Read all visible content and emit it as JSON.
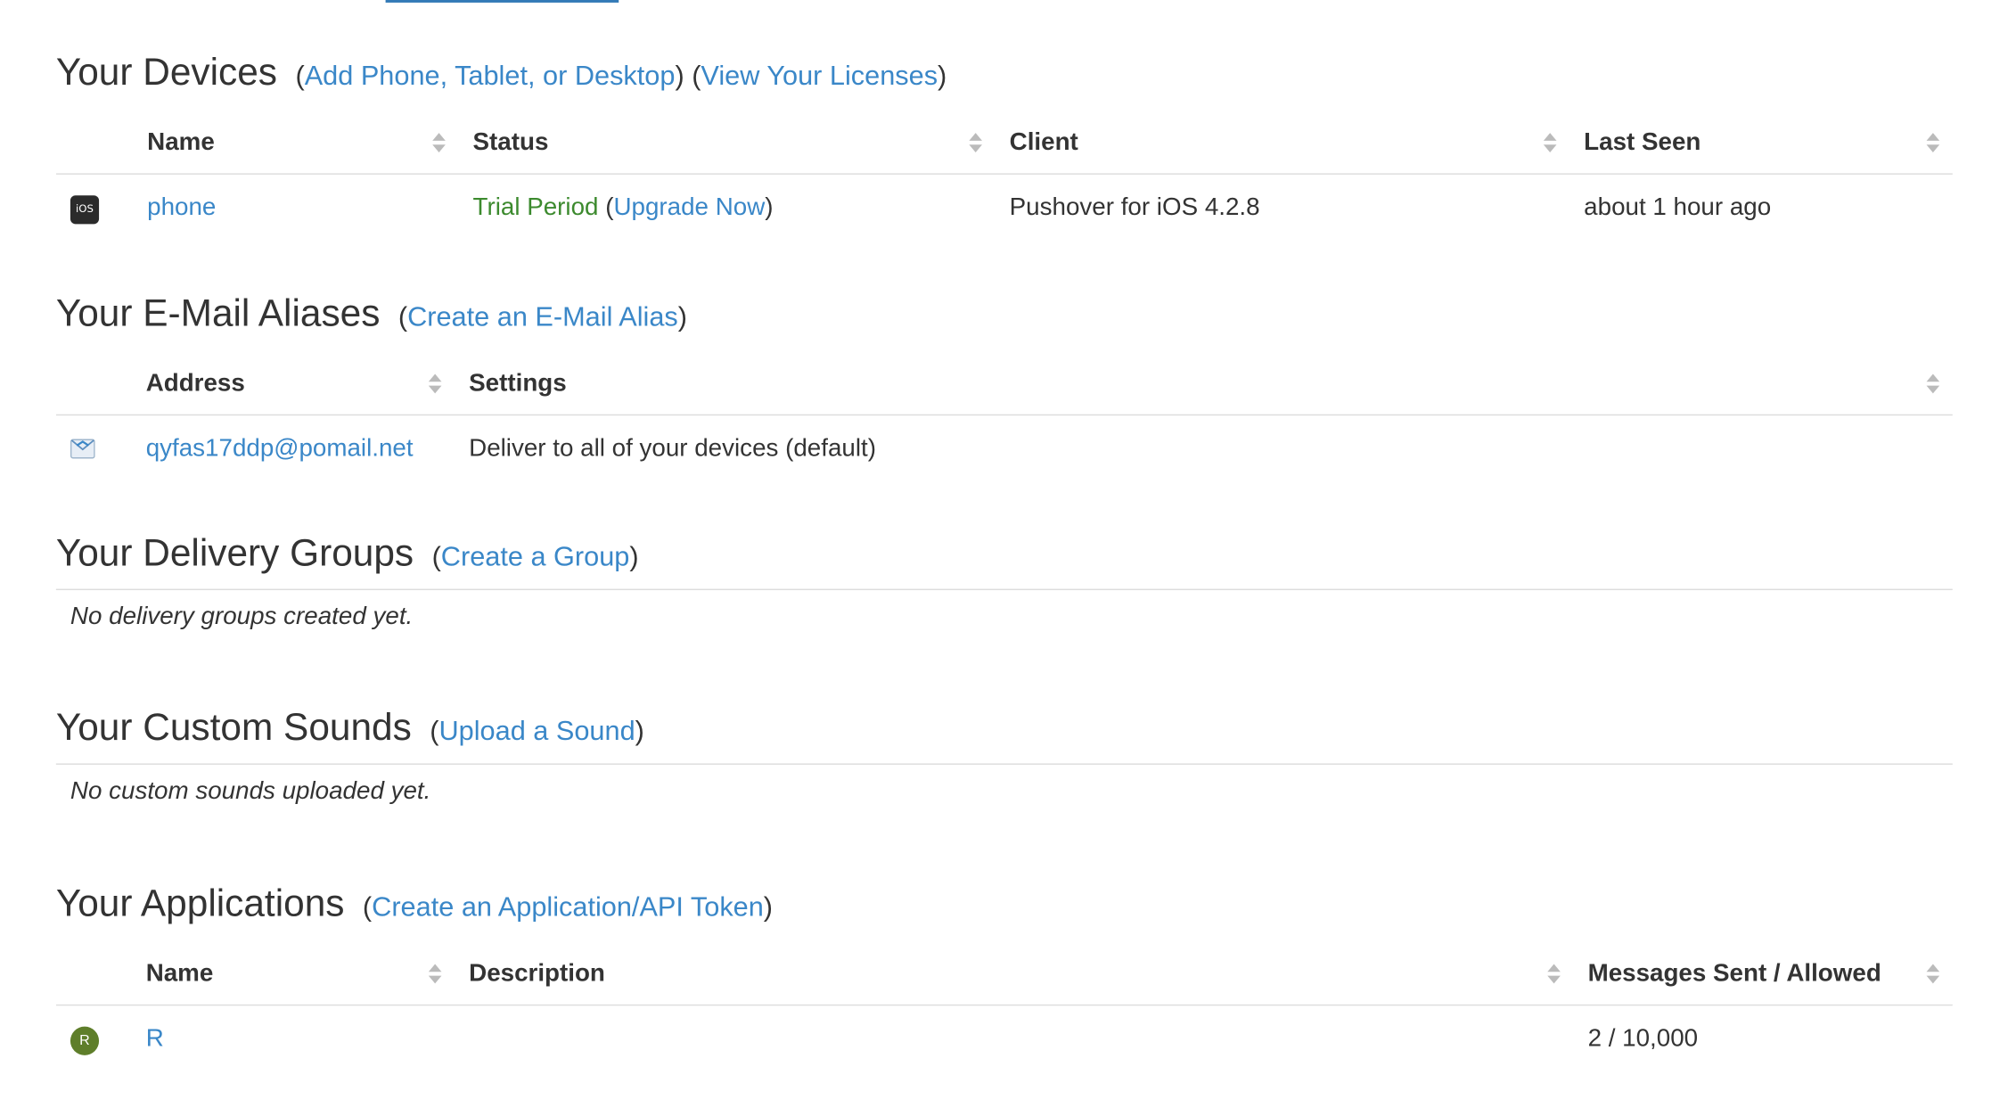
{
  "devices": {
    "title": "Your Devices",
    "link_add": "Add Phone, Tablet, or Desktop",
    "link_licenses": "View Your Licenses",
    "columns": {
      "name": "Name",
      "status": "Status",
      "client": "Client",
      "last_seen": "Last Seen"
    },
    "rows": [
      {
        "icon": "ios-icon",
        "icon_text": "iOS",
        "name": "phone",
        "status": "Trial Period",
        "upgrade": "Upgrade Now",
        "client": "Pushover for iOS 4.2.8",
        "last_seen": "about 1 hour ago"
      }
    ]
  },
  "aliases": {
    "title": "Your E-Mail Aliases",
    "link_create": "Create an E-Mail Alias",
    "columns": {
      "address": "Address",
      "settings": "Settings"
    },
    "rows": [
      {
        "icon": "mail-icon",
        "address": "qyfas17ddp@pomail.net",
        "settings": "Deliver to all of your devices (default)"
      }
    ]
  },
  "groups": {
    "title": "Your Delivery Groups",
    "link_create": "Create a Group",
    "empty_text": "No delivery groups created yet."
  },
  "sounds": {
    "title": "Your Custom Sounds",
    "link_upload": "Upload a Sound",
    "empty_text": "No custom sounds uploaded yet."
  },
  "applications": {
    "title": "Your Applications",
    "link_create": "Create an Application/API Token",
    "columns": {
      "name": "Name",
      "description": "Description",
      "messages": "Messages Sent / Allowed"
    },
    "rows": [
      {
        "icon": "app-icon",
        "icon_text": "R",
        "name": "R",
        "description": "",
        "messages": "2 / 10,000"
      }
    ]
  },
  "colors": {
    "link": "#3a87c8",
    "status_trial": "#3c8a2e",
    "app_icon_bg": "#5e7e2a"
  }
}
